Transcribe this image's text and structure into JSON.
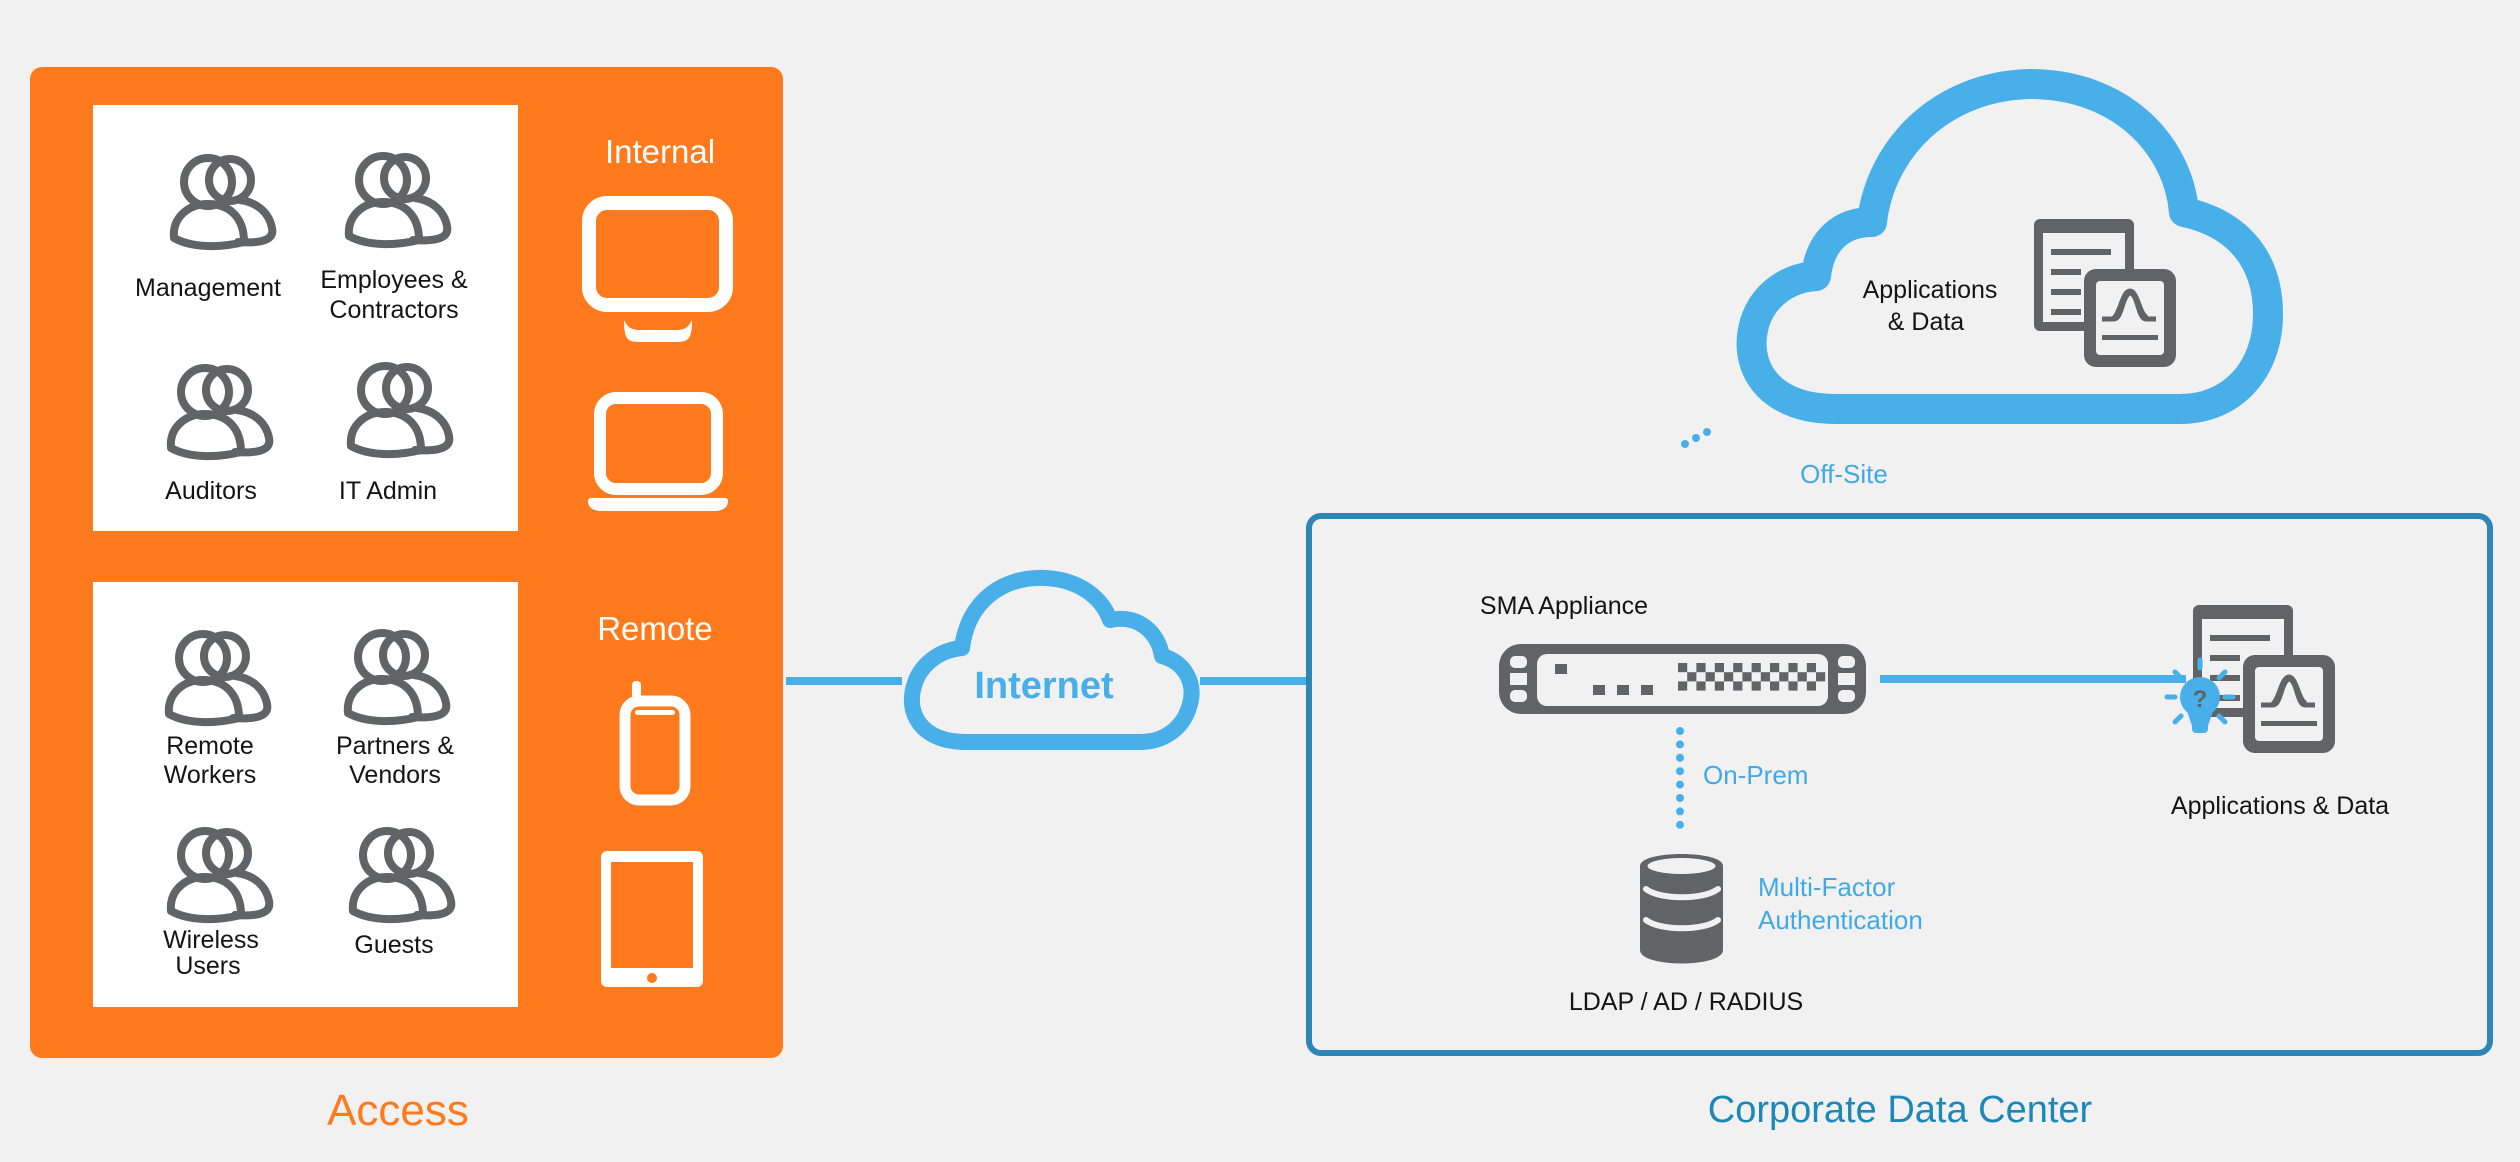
{
  "access": {
    "title": "Access",
    "internal": {
      "label": "Internal",
      "groups": [
        "Management",
        [
          "Employees &",
          "Contractors"
        ],
        "Auditors",
        "IT Admin"
      ],
      "devices": [
        "desktop-monitor-icon",
        "laptop-icon"
      ]
    },
    "remote": {
      "label": "Remote",
      "groups": [
        [
          "Remote",
          "Workers"
        ],
        [
          "Partners &",
          "Vendors"
        ],
        [
          "Wireless",
          "Users"
        ],
        "Guests"
      ],
      "devices": [
        "mobile-phone-icon",
        "tablet-icon"
      ]
    }
  },
  "internet": {
    "label": "Internet"
  },
  "offsite": {
    "label": "Off-Site",
    "apps_label": [
      "Applications",
      "& Data"
    ]
  },
  "datacenter": {
    "title": "Corporate Data Center",
    "appliance_label": "SMA Appliance",
    "onprem_label": "On-Prem",
    "mfa_label": [
      "Multi-Factor",
      "Authentication"
    ],
    "directory_label": "LDAP / AD / RADIUS",
    "apps_label": "Applications & Data"
  },
  "colors": {
    "background": "#f1f1f1",
    "access_orange": "#fe7a1d",
    "cloud_blue": "#49afe8",
    "datacenter_blue": "#2e86b6",
    "title_blue": "#1b88b8",
    "icon_gray": "#626367"
  }
}
